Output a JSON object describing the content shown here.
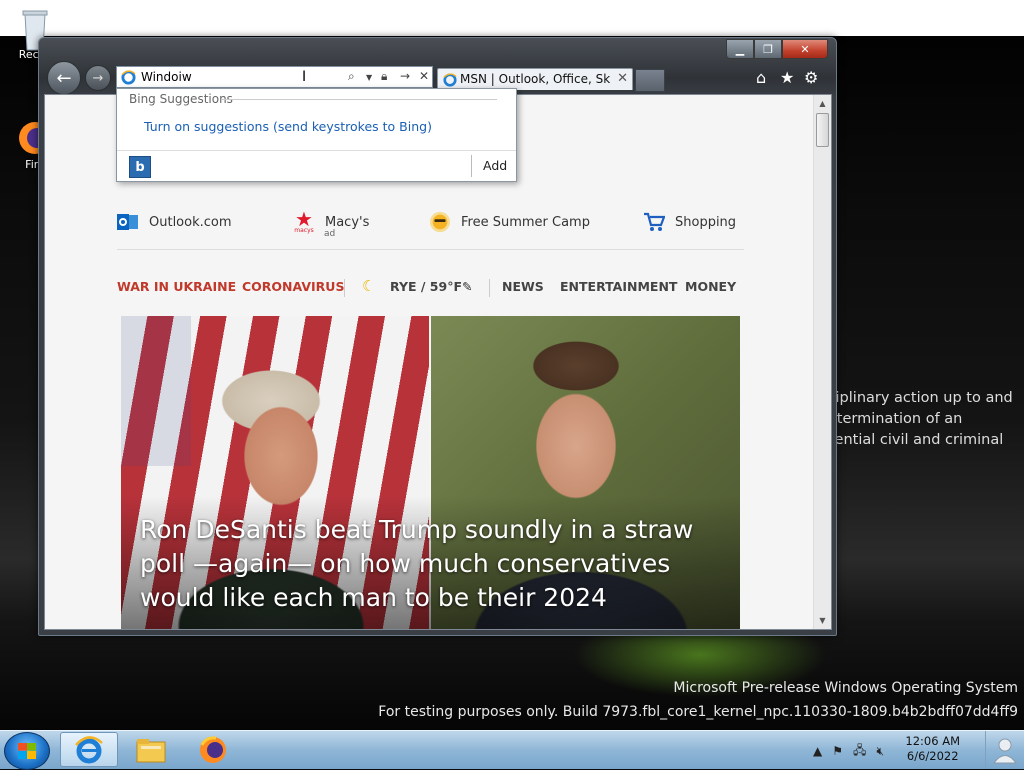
{
  "desktop": {
    "icons": [
      {
        "label": "Recyc"
      },
      {
        "label": "Fire"
      }
    ],
    "background_text": [
      "sciplinary action up to and",
      "s, termination of an",
      "otential civil and criminal"
    ],
    "watermark_line1": "Microsoft Pre-release Windows Operating System",
    "watermark_line2": "For testing purposes only. Build 7973.fbl_core1_kernel_npc.110330-1809.b4b2bdff07dd4ff9"
  },
  "browser": {
    "address_value": "Windoiw",
    "tab_title": "MSN | Outlook, Office, Sky...",
    "suggestions": {
      "header": "Bing Suggestions",
      "link": "Turn on suggestions (send keystrokes to Bing)",
      "bing_icon_letter": "b",
      "add_label": "Add"
    }
  },
  "page": {
    "quick_links": [
      {
        "label": "Outlook.com",
        "icon": "outlook-icon"
      },
      {
        "label": "Macy's",
        "icon": "macys-star-icon",
        "sub": "ad",
        "logo_text": "macys"
      },
      {
        "label": "Free Summer Camp",
        "icon": "sun-icon"
      },
      {
        "label": "Shopping",
        "icon": "cart-icon"
      }
    ],
    "nav": {
      "war": "WAR IN UKRAINE",
      "corona": "CORONAVIRUS",
      "weather": "RYE / 59°F",
      "news": "NEWS",
      "entertainment": "ENTERTAINMENT",
      "money": "MONEY"
    },
    "headline": "Ron DeSantis beat Trump soundly in a straw poll —again— on how much conservatives would like each man to be their 2024"
  },
  "taskbar": {
    "time": "12:06 AM",
    "date": "6/6/2022"
  },
  "colors": {
    "nav_red": "#c0392b",
    "link_blue": "#1a5fb4",
    "taskbar": "#8fb6d6"
  }
}
